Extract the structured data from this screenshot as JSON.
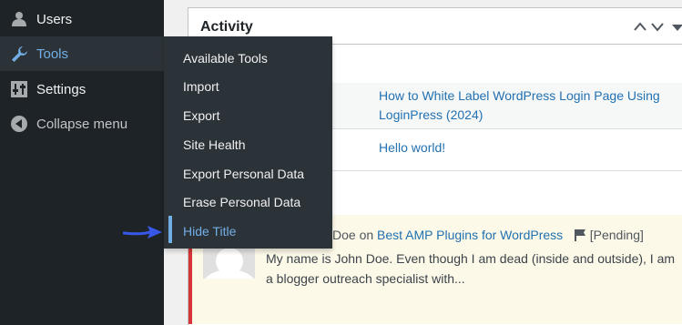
{
  "sidebar": {
    "items": [
      {
        "label": "Users",
        "icon": "user-icon"
      },
      {
        "label": "Tools",
        "icon": "wrench-icon"
      },
      {
        "label": "Settings",
        "icon": "settings-sliders-icon"
      },
      {
        "label": "Collapse menu",
        "icon": "collapse-arrow-icon"
      }
    ]
  },
  "flyout": {
    "items": [
      {
        "label": "Available Tools"
      },
      {
        "label": "Import"
      },
      {
        "label": "Export"
      },
      {
        "label": "Site Health"
      },
      {
        "label": "Export Personal Data"
      },
      {
        "label": "Erase Personal Data"
      },
      {
        "label": "Hide Title"
      }
    ]
  },
  "activity": {
    "title": "Activity",
    "posts": [
      {
        "title_line1": "How to White Label WordPress Login Page Using",
        "title_line2": "LoginPress (2024)"
      },
      {
        "title": "Hello world!"
      }
    ],
    "comment": {
      "author_fragment": "Doe",
      "on_word": "on",
      "post_link": "Best AMP Plugins for WordPress",
      "status": "[Pending]",
      "text": "My name is John Doe. Even though I am dead (inside and outside), I am a blogger outreach specialist with..."
    }
  },
  "colors": {
    "sidebar_bg": "#1d2327",
    "flyout_bg": "#2c3338",
    "accent": "#72aee6",
    "link": "#2271b1",
    "pointer": "#3858e9",
    "pending_border": "#d63638"
  }
}
